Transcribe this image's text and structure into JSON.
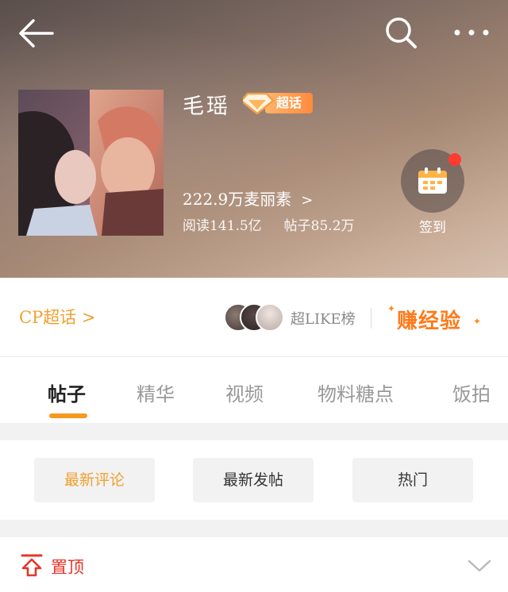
{
  "header": {
    "back_icon": "back-arrow-icon",
    "search_icon": "search-icon",
    "more_icon": "more-dots-icon",
    "title": "毛瑶",
    "badge": {
      "icon": "diamond-icon",
      "label": "超话"
    },
    "fans_text": "222.9万麦丽素",
    "fans_chevron": ">",
    "stats": {
      "reads": "阅读141.5亿",
      "posts": "帖子85.2万"
    },
    "signin": {
      "icon": "calendar-icon",
      "label": "签到",
      "has_dot": true
    }
  },
  "cp_row": {
    "cp_link": "CP超话",
    "cp_chevron": ">",
    "superlike_label": "超LIKE榜",
    "earn_exp_label": "赚经验"
  },
  "tabs": [
    {
      "label": "帖子",
      "active": true
    },
    {
      "label": "精华",
      "active": false
    },
    {
      "label": "视频",
      "active": false
    },
    {
      "label": "物料糖点",
      "active": false
    },
    {
      "label": "饭拍",
      "active": false
    }
  ],
  "filters": [
    {
      "label": "最新评论",
      "active": true
    },
    {
      "label": "最新发帖",
      "active": false
    },
    {
      "label": "热门",
      "active": false
    }
  ],
  "pinned": {
    "icon": "pin-top-icon",
    "label": "置顶",
    "chevron_icon": "chevron-down-icon"
  },
  "colors": {
    "accent": "#f0a030",
    "tab_underline": "#f59a1f",
    "pinned": "#e8342a",
    "badge": "#ff8a3d",
    "notification_dot": "#ff3b30"
  }
}
